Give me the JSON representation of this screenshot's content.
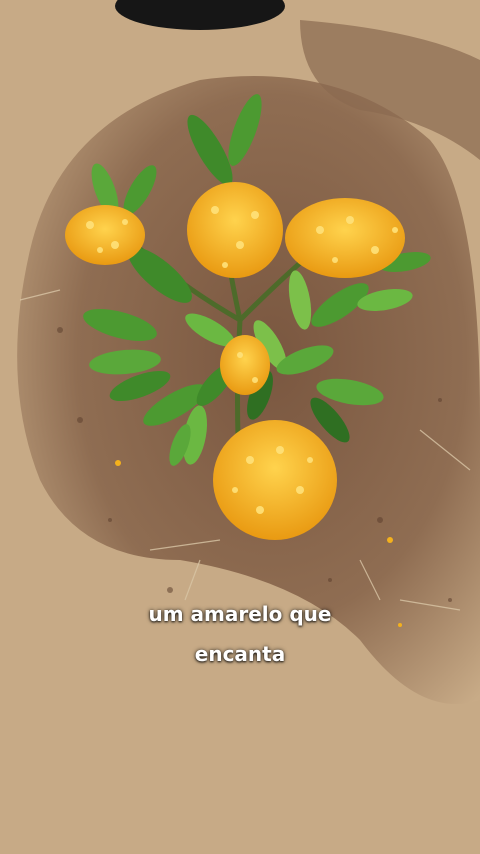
{
  "caption": {
    "line1": "um amarelo que",
    "line2": "encanta"
  },
  "colors": {
    "soil_light": "#c9ad88",
    "soil_dark": "#6b4a36",
    "leaf": "#3f8a2a",
    "leaf_light": "#7cc04a",
    "flower": "#f4b11c",
    "flower_light": "#ffd34d",
    "pot": "#1a1a1a"
  }
}
